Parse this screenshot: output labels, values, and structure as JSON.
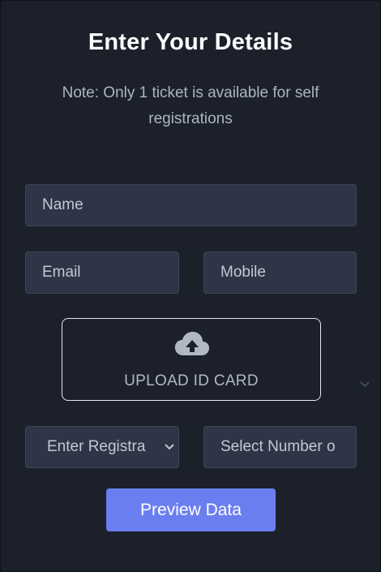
{
  "header": {
    "title": "Enter Your Details",
    "note": "Note: Only 1 ticket is available for self registrations"
  },
  "form": {
    "name_placeholder": "Name",
    "email_placeholder": "Email",
    "mobile_placeholder": "Mobile",
    "upload_label": "UPLOAD ID CARD",
    "upload_icon": "cloud-upload-icon",
    "registration_select": "Enter Registra",
    "number_select": "Select Number o",
    "preview_button": "Preview Data"
  },
  "colors": {
    "background": "#1b202b",
    "field": "#2e3546",
    "accent": "#6b7ef0"
  }
}
